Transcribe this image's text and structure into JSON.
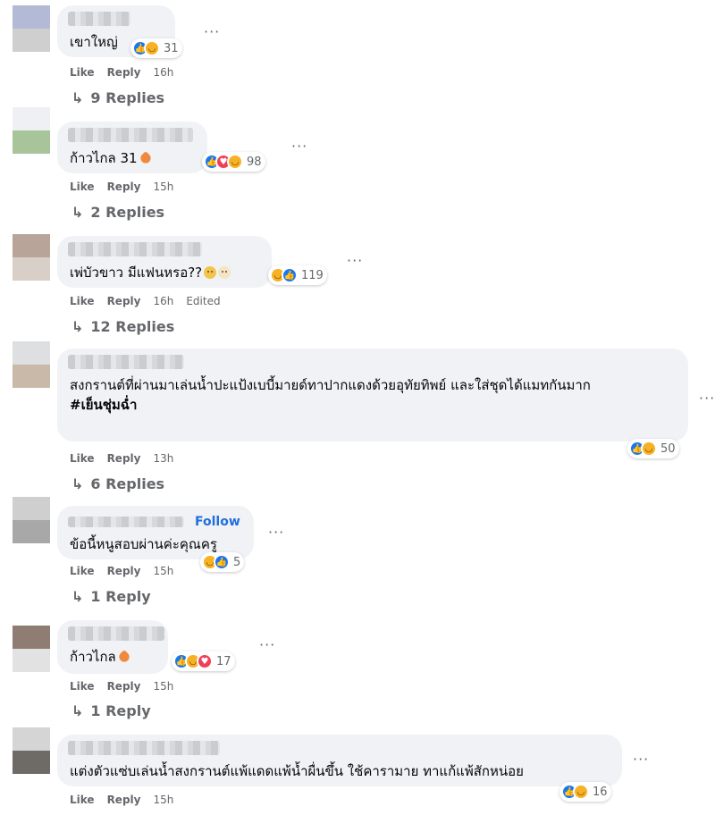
{
  "colors": {
    "like": "#1877f2",
    "haha": "#f7b125",
    "love": "#f33e58",
    "follow": "#216fdb",
    "bubble": "#f0f2f5",
    "meta": "#65676b"
  },
  "labels": {
    "like": "Like",
    "reply": "Reply",
    "edited": "Edited",
    "follow": "Follow",
    "more": "···"
  },
  "comments": [
    {
      "text": "เขาใหญ่",
      "reactions": [
        "like-icon",
        "haha-icon"
      ],
      "count": "31",
      "time": "16h",
      "replies": "9 Replies"
    },
    {
      "text": "ก้าวไกล 31",
      "reactions": [
        "like-icon",
        "love-icon",
        "haha-icon"
      ],
      "count": "98",
      "time": "15h",
      "replies": "2 Replies"
    },
    {
      "text": "เพ่บัวขาว มีแฟนหรอ??",
      "reactions": [
        "haha-icon",
        "like-icon"
      ],
      "count": "119",
      "time": "16h",
      "replies": "12 Replies"
    },
    {
      "text": "สงกรานต์ที่ผ่านมาเล่นน้ำปะแป้งเบบี้มายด์ทาปากแดงด้วยอุทัยทิพย์ และใส่ชุดได้แมทกันมาก",
      "tag": "#เย็นชุ่มฉ่ำ",
      "reactions": [
        "like-icon",
        "haha-icon"
      ],
      "count": "50",
      "time": "13h",
      "replies": "6 Replies"
    },
    {
      "text": "ข้อนี้หนูสอบผ่านค่ะคุณครู",
      "reactions": [
        "haha-icon",
        "like-icon"
      ],
      "count": "5",
      "time": "15h",
      "replies": "1 Reply"
    },
    {
      "text": "ก้าวไกล",
      "reactions": [
        "like-icon",
        "haha-icon",
        "love-icon"
      ],
      "count": "17",
      "time": "15h",
      "replies": "1 Reply"
    },
    {
      "text": "แต่งตัวแซ่บเล่นน้ำสงกรานต์แพ้แดดแพ้น้ำผื่นขึ้น ใช้คารามาย ทาแก้แพ้สักหน่อย",
      "reactions": [
        "like-icon",
        "haha-icon"
      ],
      "count": "16",
      "time": "15h"
    }
  ]
}
